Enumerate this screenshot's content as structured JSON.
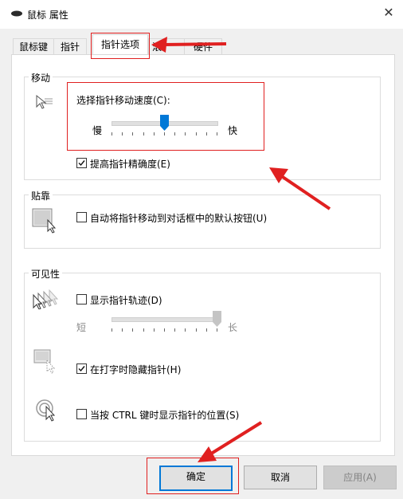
{
  "window": {
    "title": "鼠标 属性",
    "close_icon": "close-icon"
  },
  "tabs": [
    {
      "label": "鼠标键"
    },
    {
      "label": "指针"
    },
    {
      "label": "指针选项",
      "active": true
    },
    {
      "label": "滚"
    },
    {
      "label": "硬件"
    }
  ],
  "motion": {
    "group_label": "移动",
    "speed_label": "选择指针移动速度(C):",
    "slow": "慢",
    "fast": "快",
    "speed_value_fraction": 0.5,
    "enhance_label": "提高指针精确度(E)",
    "enhance_checked": true
  },
  "snap": {
    "group_label": "贴靠",
    "label": "自动将指针移动到对话框中的默认按钮(U)",
    "checked": false
  },
  "visibility": {
    "group_label": "可见性",
    "trails_label": "显示指针轨迹(D)",
    "trails_checked": false,
    "short": "短",
    "long": "长",
    "trails_value_fraction": 1.0,
    "hide_label": "在打字时隐藏指针(H)",
    "hide_checked": true,
    "ctrl_label": "当按 CTRL 键时显示指针的位置(S)",
    "ctrl_checked": false
  },
  "buttons": {
    "ok": "确定",
    "cancel": "取消",
    "apply": "应用(A)"
  },
  "colors": {
    "accent": "#0078d7",
    "annotation": "#e02020"
  }
}
